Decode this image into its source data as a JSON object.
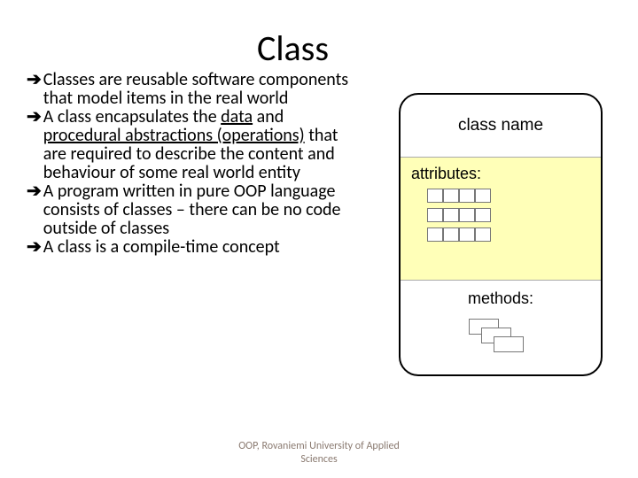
{
  "title": "Class",
  "bullets": [
    {
      "plain": "Classes are reusable software components that model items in the real world"
    },
    {
      "segments": [
        "A class encapsulates the ",
        {
          "u": "data"
        },
        " and ",
        {
          "u": "procedural abstractions (operations)"
        },
        " that are required to describe the content and behaviour of some real world entity"
      ]
    },
    {
      "plain": "A program written in pure OOP language consists of classes – there can be no code outside of classes"
    },
    {
      "plain": "A class is a compile-time concept"
    }
  ],
  "diagram": {
    "class_name_label": "class name",
    "attributes_label": "attributes:",
    "methods_label": "methods:"
  },
  "footer": {
    "line1": "OOP, Rovaniemi University of Applied",
    "line2": "Sciences"
  }
}
